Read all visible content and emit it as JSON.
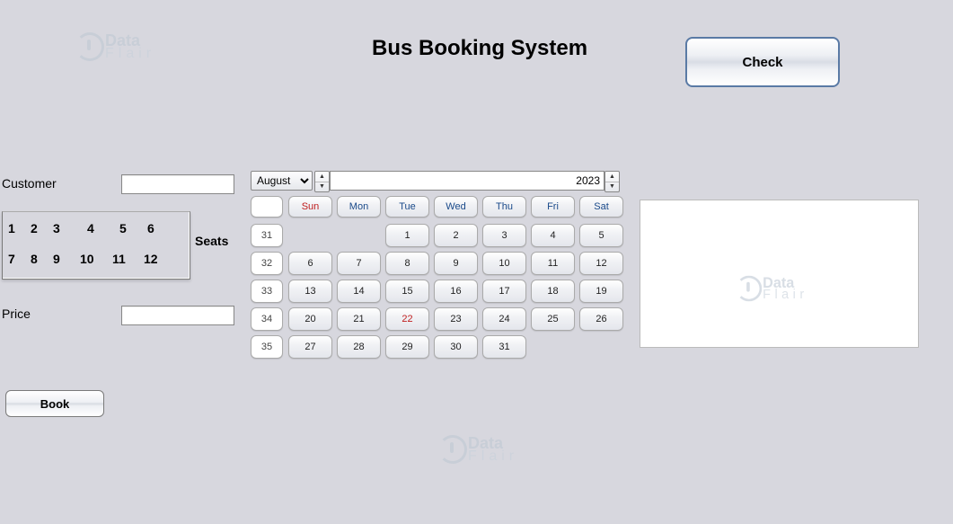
{
  "title": "Bus Booking System",
  "buttons": {
    "check": "Check",
    "book": "Book"
  },
  "labels": {
    "customer": "Customer",
    "seats": "Seats",
    "price": "Price"
  },
  "inputs": {
    "customer_value": "",
    "price_value": ""
  },
  "seats": [
    "1",
    "2",
    "3",
    "4",
    "5",
    "6",
    "7",
    "8",
    "9",
    "10",
    "11",
    "12"
  ],
  "calendar": {
    "month": "August",
    "year": "2023",
    "day_headers": [
      "Sun",
      "Mon",
      "Tue",
      "Wed",
      "Thu",
      "Fri",
      "Sat"
    ],
    "week_numbers": [
      "31",
      "32",
      "33",
      "34",
      "35"
    ],
    "rows": [
      [
        "",
        "",
        "1",
        "2",
        "3",
        "4",
        "5"
      ],
      [
        "6",
        "7",
        "8",
        "9",
        "10",
        "11",
        "12"
      ],
      [
        "13",
        "14",
        "15",
        "16",
        "17",
        "18",
        "19"
      ],
      [
        "20",
        "21",
        "22",
        "23",
        "24",
        "25",
        "26"
      ],
      [
        "27",
        "28",
        "29",
        "30",
        "31",
        "",
        ""
      ]
    ],
    "today": "22"
  },
  "watermark": {
    "line1": "Data",
    "line2": "Flair"
  }
}
